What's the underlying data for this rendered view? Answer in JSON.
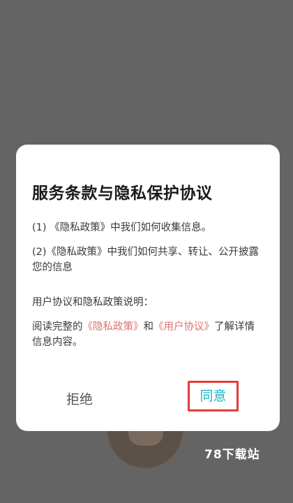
{
  "dialog": {
    "title": "服务条款与隐私保护协议",
    "line1": "(1) 《隐私政策》中我们如何收集信息。",
    "line2": "(2)《隐私政策》中我们如何共享、转让、公开披露您的信息",
    "line3": "用户协议和隐私政策说明：",
    "line4_prefix": "阅读完整的",
    "line4_link1": "《隐私政策》",
    "line4_and": "和",
    "line4_link2": "《用户协议》",
    "line4_suffix": "了解详情信息内容。",
    "reject_label": "拒绝",
    "agree_label": "同意"
  },
  "watermark": "78下载站",
  "colors": {
    "overlay": "#646464",
    "link": "#e0706e",
    "agree_text": "#19b4c7",
    "agree_highlight_border": "#e53b3b"
  }
}
